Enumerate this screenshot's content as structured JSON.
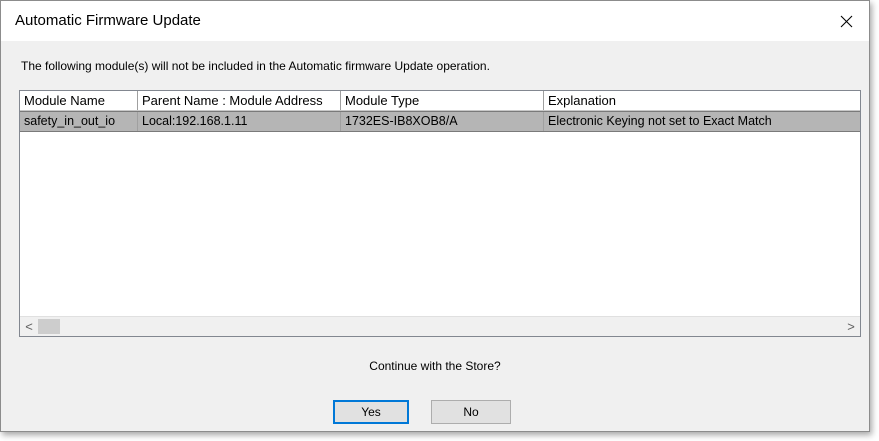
{
  "window": {
    "title": "Automatic Firmware Update",
    "close_glyph": "✕"
  },
  "message": "The following module(s) will not be included in the Automatic firmware Update operation.",
  "table": {
    "columns": [
      "Module Name",
      "Parent Name : Module Address",
      "Module Type",
      "Explanation"
    ],
    "rows": [
      [
        "safety_in_out_io",
        "Local:192.168.1.11",
        "1732ES-IB8XOB8/A",
        "Electronic Keying not set to Exact Match"
      ]
    ],
    "selected_row": 0
  },
  "scrollbar": {
    "left_glyph": "<",
    "right_glyph": ">"
  },
  "question": "Continue with the Store?",
  "buttons": {
    "yes_label": "Yes",
    "no_label": "No"
  },
  "colors": {
    "selection": "#b5b5b5",
    "default_button_border": "#0078d7"
  }
}
